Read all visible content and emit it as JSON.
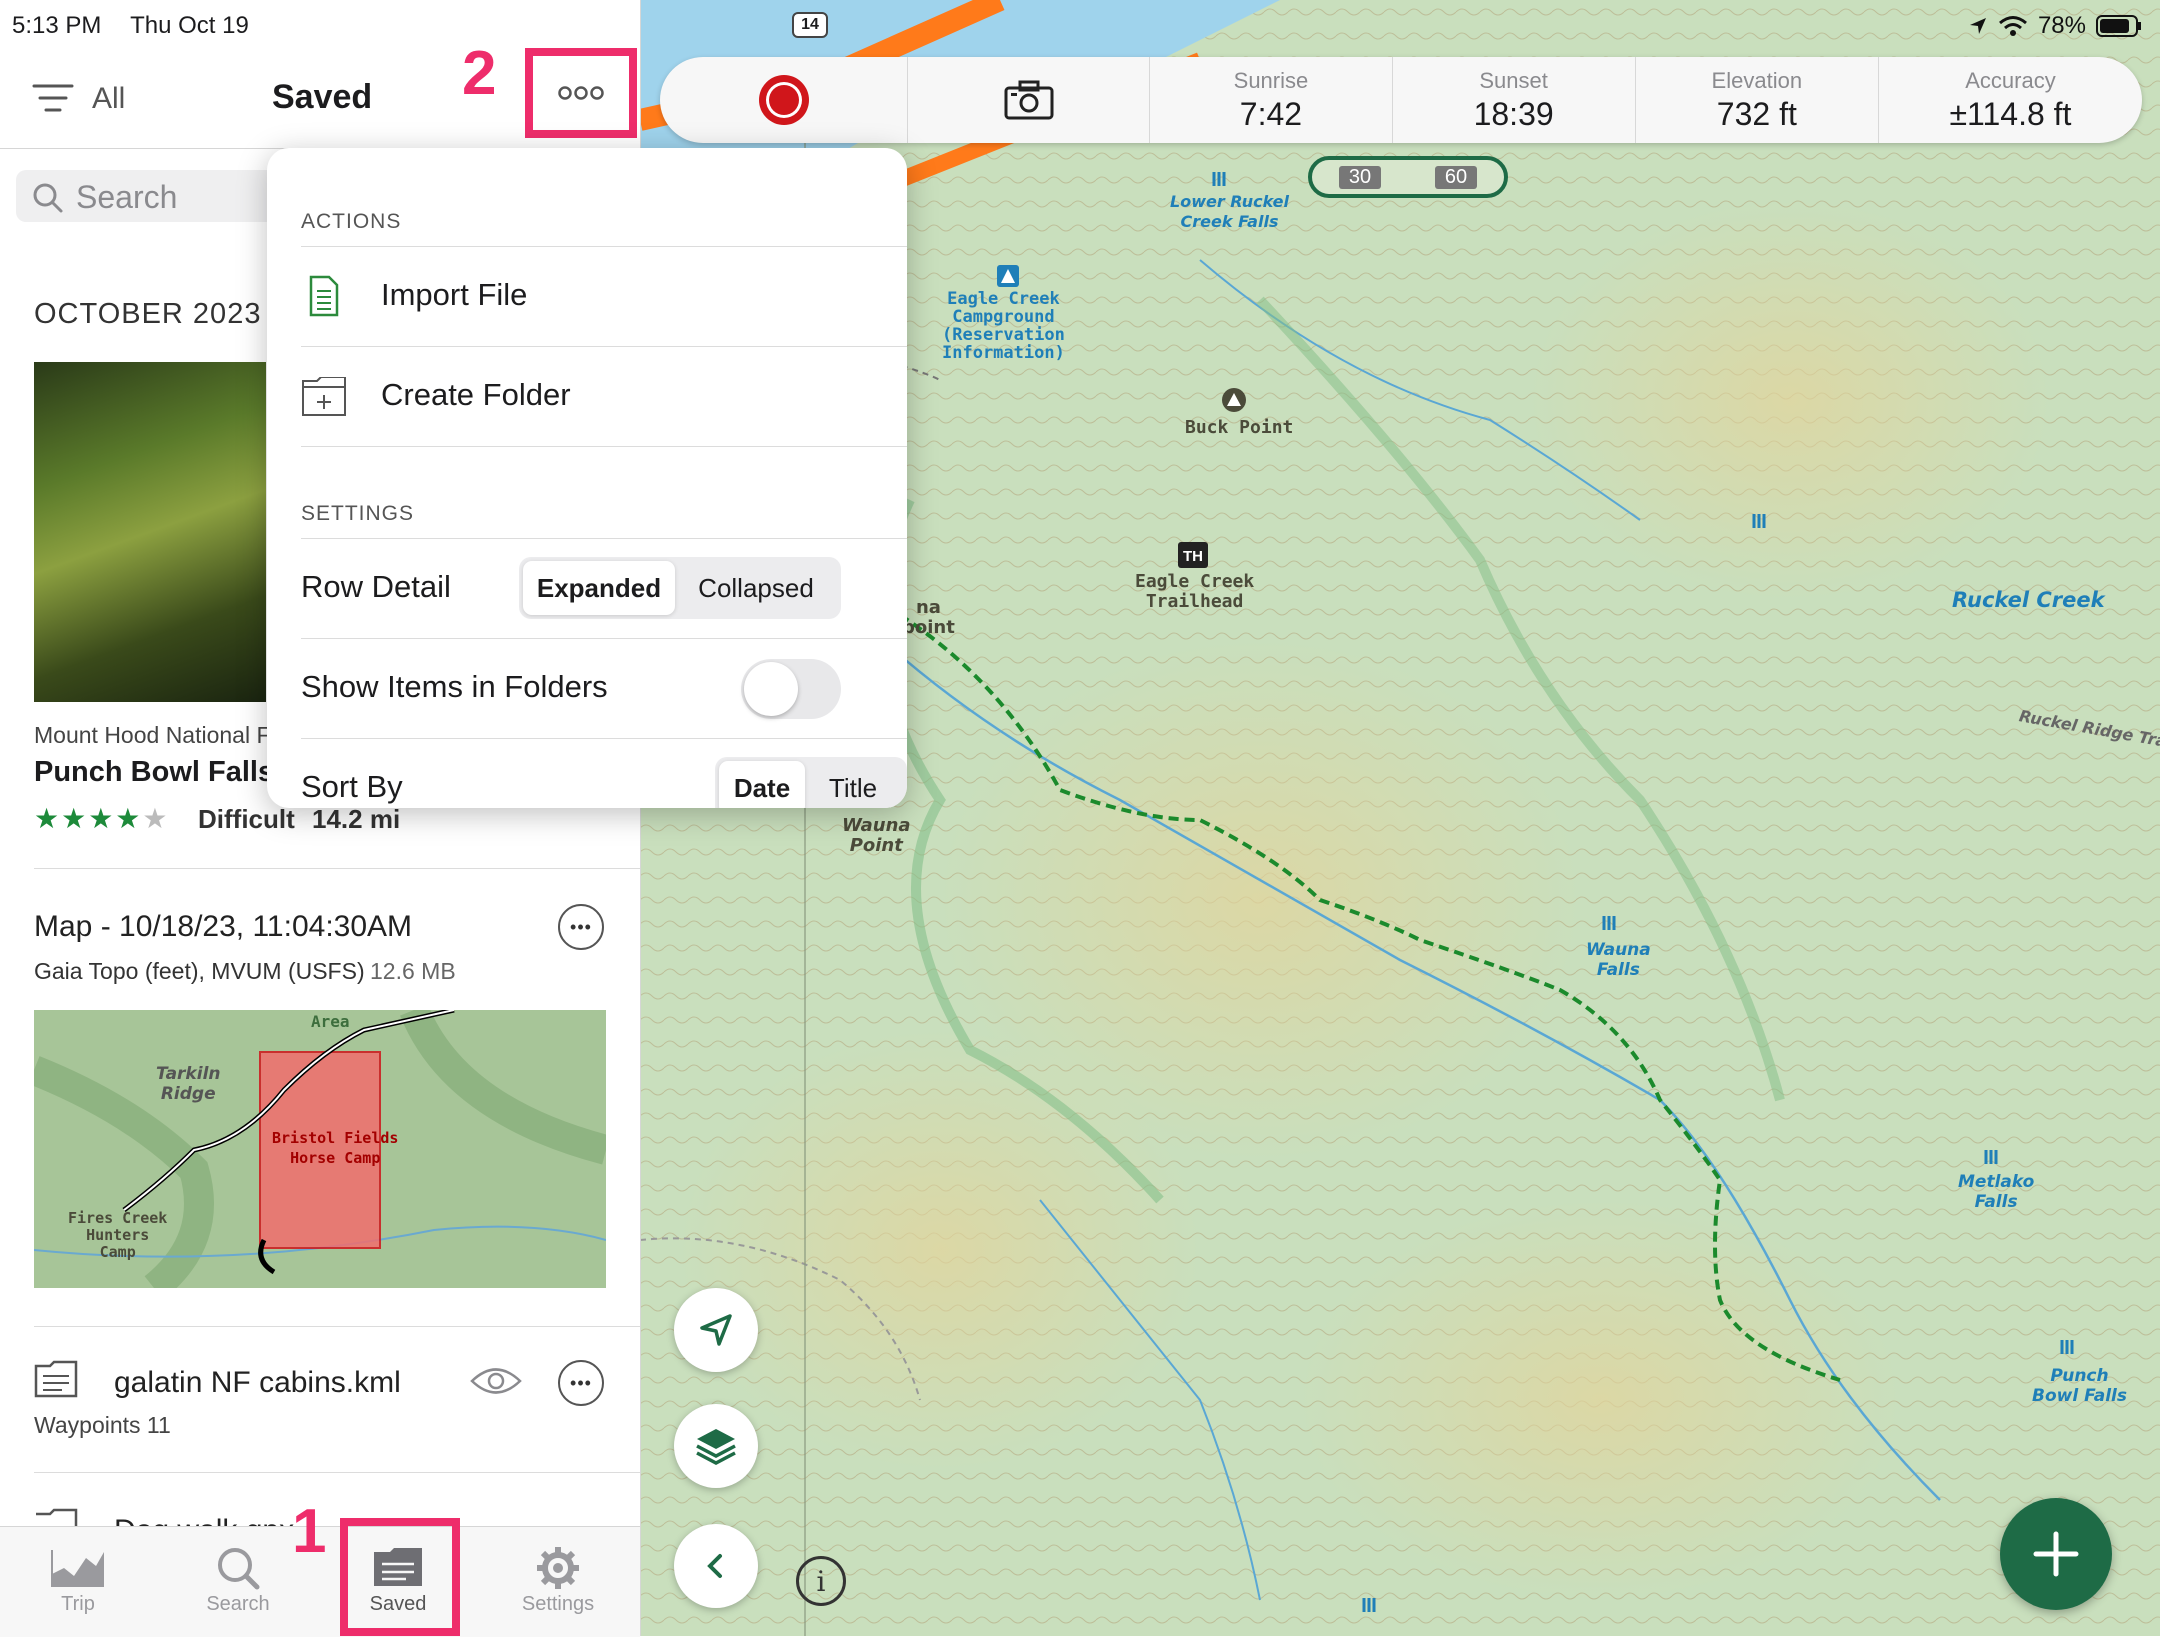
{
  "status": {
    "time": "5:13 PM",
    "date": "Thu Oct 19",
    "battery": "78%"
  },
  "sidebar": {
    "filter_label": "All",
    "title": "Saved",
    "search_placeholder": "Search",
    "section_header": "OCTOBER 2023",
    "items": [
      {
        "subtitle": "Mount Hood National F",
        "title": "Punch Bowl Falls",
        "rating": 4,
        "difficulty": "Difficult",
        "distance": "14.2 mi"
      },
      {
        "title": "Map - 10/18/23, 11:04:30AM",
        "subtitle": "Gaia Topo (feet), MVUM (USFS)",
        "size": "12.6 MB",
        "thumb_labels": {
          "ridge": "Tarkiln\nRidge",
          "camp": "Bristol Fields\nHorse Camp",
          "hunters": "Fires Creek\nHunters\nCamp",
          "area": "Area"
        }
      },
      {
        "title": "galatin NF cabins.kml",
        "subtitle": "Waypoints 11"
      },
      {
        "title": "Dog walk.gpx"
      }
    ]
  },
  "tabbar": {
    "tabs": [
      {
        "label": "Trip"
      },
      {
        "label": "Search"
      },
      {
        "label": "Saved"
      },
      {
        "label": "Settings"
      }
    ]
  },
  "annotations": {
    "step1": "1",
    "step2": "2",
    "highlight_color": "#ee2d6b"
  },
  "popover": {
    "actions_header": "ACTIONS",
    "import_file": "Import File",
    "create_folder": "Create Folder",
    "settings_header": "SETTINGS",
    "row_detail": {
      "label": "Row Detail",
      "options": [
        "Expanded",
        "Collapsed"
      ],
      "selected": "Expanded"
    },
    "show_items_in_folders": {
      "label": "Show Items in Folders",
      "on": false
    },
    "sort_by": {
      "label": "Sort By",
      "options": [
        "Date",
        "Title"
      ],
      "selected": "Date"
    }
  },
  "infobar": {
    "sunrise": {
      "label": "Sunrise",
      "value": "7:42"
    },
    "sunset": {
      "label": "Sunset",
      "value": "18:39"
    },
    "elevation": {
      "label": "Elevation",
      "value": "732 ft"
    },
    "accuracy": {
      "label": "Accuracy",
      "value": "±114.8 ft"
    }
  },
  "map": {
    "road_shield": "14",
    "scale": {
      "left": "30",
      "right": "60"
    },
    "labels": {
      "lower_ruckel": "Lower Ruckel\nCreek Falls",
      "eagle_creek_campground": "Eagle Creek\nCampground\n(Reservation\nInformation)",
      "buck_point": "Buck Point",
      "eagle_creek_trailhead": "Eagle Creek\nTrailhead",
      "ruckel_creek": "Ruckel Creek",
      "ruckel_ridge_trail": "Ruckel Ridge Trail",
      "wauna_point": "Wauna\nPoint",
      "wauna_falls": "Wauna\nFalls",
      "metlako_falls": "Metlako\nFalls",
      "punch_bowl_falls": "Punch\nBowl Falls",
      "partial_point": "na\npoint"
    },
    "colors": {
      "accent": "#1e6b46",
      "record": "#d0161b",
      "water": "#1f7fb8"
    }
  }
}
